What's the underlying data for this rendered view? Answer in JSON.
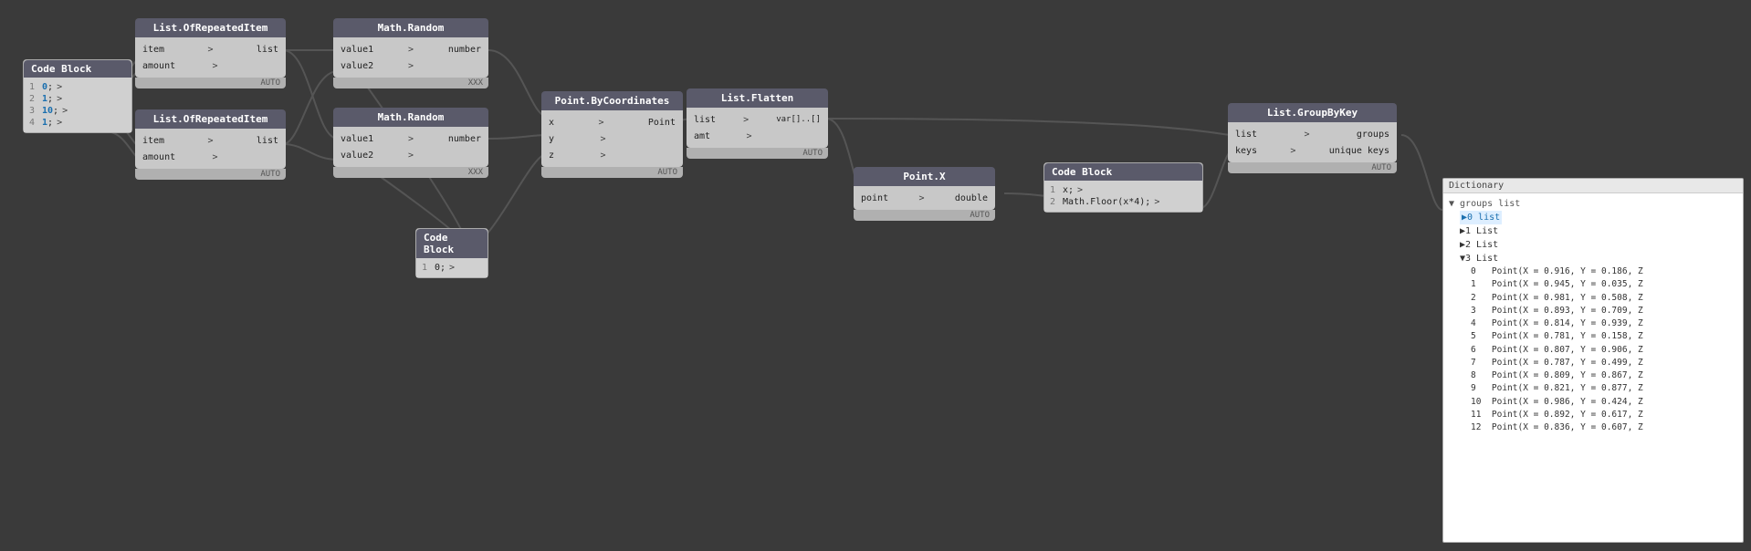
{
  "nodes": {
    "codeBlock1": {
      "title": "Code Block",
      "lines": [
        {
          "num": "1",
          "text": "0",
          "blue": true,
          "port": true
        },
        {
          "num": "2",
          "text": "1",
          "blue": true,
          "port": true
        },
        {
          "num": "3",
          "text": "10",
          "blue": true,
          "port": true
        },
        {
          "num": "4",
          "text": "1",
          "blue": true,
          "port": true
        }
      ]
    },
    "listRepeated1": {
      "title": "List.OfRepeatedItem",
      "inputs": [
        "item",
        "amount"
      ],
      "outputs": [
        "list"
      ],
      "footer": "AUTO"
    },
    "listRepeated2": {
      "title": "List.OfRepeatedItem",
      "inputs": [
        "item",
        "amount"
      ],
      "outputs": [
        "list"
      ],
      "footer": "AUTO"
    },
    "mathRandom1": {
      "title": "Math.Random",
      "inputs": [
        "value1",
        "value2"
      ],
      "outputs": [
        "number"
      ],
      "footer": "XXX"
    },
    "mathRandom2": {
      "title": "Math.Random",
      "inputs": [
        "value1",
        "value2"
      ],
      "outputs": [
        "number"
      ],
      "footer": "XXX"
    },
    "codeBlock2": {
      "title": "Code Block",
      "lines": [
        {
          "num": "1",
          "text": "0",
          "blue": false,
          "port": true
        }
      ]
    },
    "pointByCoords": {
      "title": "Point.ByCoordinates",
      "inputs": [
        "x",
        "y",
        "z"
      ],
      "outputs": [
        "Point"
      ],
      "footer": "AUTO"
    },
    "listFlatten": {
      "title": "List.Flatten",
      "inputs": [
        "list",
        "amt"
      ],
      "outputs": [
        "var[]..[]"
      ],
      "footer": "AUTO"
    },
    "pointX": {
      "title": "Point.X",
      "inputs": [
        "point"
      ],
      "outputs": [
        "double"
      ],
      "footer": "AUTO"
    },
    "codeBlock3": {
      "title": "Code Block",
      "lines": [
        {
          "num": "1",
          "text": "x;",
          "port": true
        },
        {
          "num": "2",
          "text": "Math.Floor(x*4);",
          "port": true
        }
      ]
    },
    "listGroupByKey": {
      "title": "List.GroupByKey",
      "inputs": [
        "list",
        "keys"
      ],
      "outputs": [
        "groups",
        "unique keys"
      ],
      "footer": "AUTO"
    }
  },
  "preview": {
    "title": "Dictionary",
    "groups_label": "groups list",
    "items": [
      {
        "label": "▶0 list",
        "highlight": true
      },
      {
        "label": "▶1 List"
      },
      {
        "label": "▶2 List"
      },
      {
        "label": "▼3 List"
      },
      {
        "sub_items": [
          "0   Point(X = 0.916, Y = 0.186, Z",
          "1   Point(X = 0.945, Y = 0.035, Z",
          "2   Point(X = 0.981, Y = 0.508, Z",
          "3   Point(X = 0.893, Y = 0.709, Z",
          "4   Point(X = 0.814, Y = 0.939, Z",
          "5   Point(X = 0.781, Y = 0.158, Z",
          "6   Point(X = 0.807, Y = 0.906, Z",
          "7   Point(X = 0.787, Y = 0.499, Z",
          "8   Point(X = 0.809, Y = 0.867, Z",
          "9   Point(X = 0.821, Y = 0.877, Z",
          "10  Point(X = 0.986, Y = 0.424, Z",
          "11  Point(X = 0.892, Y = 0.617, Z",
          "12  Point(X = 0.836, Y = 0.607, Z"
        ]
      }
    ]
  }
}
